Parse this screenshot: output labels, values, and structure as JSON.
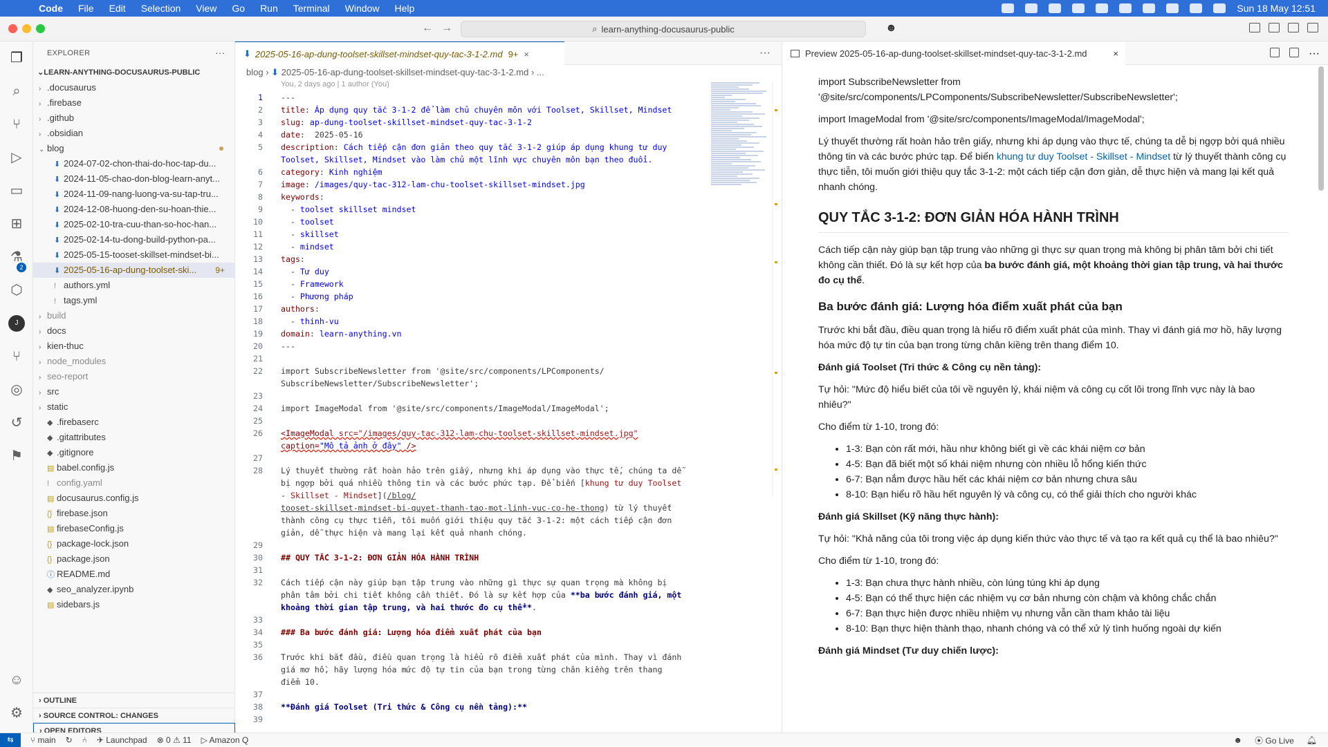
{
  "menubar": {
    "app": "Code",
    "items": [
      "File",
      "Edit",
      "Selection",
      "View",
      "Go",
      "Run",
      "Terminal",
      "Window",
      "Help"
    ],
    "datetime": "Sun 18 May  12:51"
  },
  "titlebar": {
    "search": "learn-anything-docusaurus-public"
  },
  "explorer": {
    "title": "EXPLORER",
    "root": "LEARN-ANYTHING-DOCUSAURUS-PUBLIC",
    "tree": [
      {
        "label": ".docusaurus",
        "depth": 1,
        "kind": "folder"
      },
      {
        "label": ".firebase",
        "depth": 1,
        "kind": "folder"
      },
      {
        "label": ".github",
        "depth": 1,
        "kind": "folder"
      },
      {
        "label": ".obsidian",
        "depth": 1,
        "kind": "folder"
      },
      {
        "label": "blog",
        "depth": 1,
        "kind": "folder-open"
      },
      {
        "label": "2024-07-02-chon-thai-do-hoc-tap-du...",
        "depth": 2,
        "kind": "md"
      },
      {
        "label": "2024-11-05-chao-don-blog-learn-anyt...",
        "depth": 2,
        "kind": "md"
      },
      {
        "label": "2024-11-09-nang-luong-va-su-tap-tru...",
        "depth": 2,
        "kind": "md"
      },
      {
        "label": "2024-12-08-huong-den-su-hoan-thie...",
        "depth": 2,
        "kind": "md"
      },
      {
        "label": "2025-02-10-tra-cuu-than-so-hoc-han...",
        "depth": 2,
        "kind": "md"
      },
      {
        "label": "2025-02-14-tu-dong-build-python-pa...",
        "depth": 2,
        "kind": "md"
      },
      {
        "label": "2025-05-15-tooset-skillset-mindset-bi...",
        "depth": 2,
        "kind": "md"
      },
      {
        "label": "2025-05-16-ap-dung-toolset-ski...",
        "depth": 2,
        "kind": "md",
        "selected": true,
        "badge": "9+"
      },
      {
        "label": "authors.yml",
        "depth": 2,
        "kind": "yml"
      },
      {
        "label": "tags.yml",
        "depth": 2,
        "kind": "yml"
      },
      {
        "label": "build",
        "depth": 1,
        "kind": "folder",
        "dim": true
      },
      {
        "label": "docs",
        "depth": 1,
        "kind": "folder"
      },
      {
        "label": "kien-thuc",
        "depth": 1,
        "kind": "folder"
      },
      {
        "label": "node_modules",
        "depth": 1,
        "kind": "folder",
        "dim": true
      },
      {
        "label": "seo-report",
        "depth": 1,
        "kind": "folder",
        "dim": true
      },
      {
        "label": "src",
        "depth": 1,
        "kind": "folder"
      },
      {
        "label": "static",
        "depth": 1,
        "kind": "folder"
      },
      {
        "label": ".firebaserc",
        "depth": 1,
        "kind": "file"
      },
      {
        "label": ".gitattributes",
        "depth": 1,
        "kind": "file"
      },
      {
        "label": ".gitignore",
        "depth": 1,
        "kind": "file"
      },
      {
        "label": "babel.config.js",
        "depth": 1,
        "kind": "js"
      },
      {
        "label": "config.yaml",
        "depth": 1,
        "kind": "yml",
        "dim": true
      },
      {
        "label": "docusaurus.config.js",
        "depth": 1,
        "kind": "js"
      },
      {
        "label": "firebase.json",
        "depth": 1,
        "kind": "json"
      },
      {
        "label": "firebaseConfig.js",
        "depth": 1,
        "kind": "js"
      },
      {
        "label": "package-lock.json",
        "depth": 1,
        "kind": "json"
      },
      {
        "label": "package.json",
        "depth": 1,
        "kind": "json"
      },
      {
        "label": "README.md",
        "depth": 1,
        "kind": "info"
      },
      {
        "label": "seo_analyzer.ipynb",
        "depth": 1,
        "kind": "file"
      },
      {
        "label": "sidebars.js",
        "depth": 1,
        "kind": "js"
      }
    ],
    "sections": [
      "OUTLINE",
      "SOURCE CONTROL: CHANGES",
      "OPEN EDITORS"
    ]
  },
  "editor": {
    "tab": {
      "name": "2025-05-16-ap-dung-toolset-skillset-mindset-quy-tac-3-1-2.md",
      "badge": "9+"
    },
    "breadcrumb": [
      "blog",
      "2025-05-16-ap-dung-toolset-skillset-mindset-quy-tac-3-1-2.md",
      "..."
    ],
    "blame": "You, 2 days ago | 1 author (You)"
  },
  "preview": {
    "tab": "Preview 2025-05-16-ap-dung-toolset-skillset-mindset-quy-tac-3-1-2.md",
    "import1": "import SubscribeNewsletter from '@site/src/components/LPComponents/SubscribeNewsletter/SubscribeNewsletter';",
    "import2": "import ImageModal from '@site/src/components/ImageModal/ImageModal';",
    "p1a": "Lý thuyết thường rất hoàn hảo trên giấy, nhưng khi áp dụng vào thực tế, chúng ta dễ bị ngợp bởi quá nhiều thông tin và các bước phức tạp. Để biến ",
    "p1link": "khung tư duy Toolset - Skillset - Mindset",
    "p1b": " từ lý thuyết thành công cụ thực tiễn, tôi muốn giới thiệu quy tắc 3-1-2: một cách tiếp cận đơn giản, dễ thực hiện và mang lại kết quả nhanh chóng.",
    "h2": "QUY TẮC 3-1-2: ĐƠN GIẢN HÓA HÀNH TRÌNH",
    "p2a": "Cách tiếp cận này giúp bạn tập trung vào những gì thực sự quan trọng mà không bị phân tâm bởi chi tiết không cần thiết. Đó là sự kết hợp của ",
    "p2b": "ba bước đánh giá, một khoảng thời gian tập trung, và hai thước đo cụ thể",
    "p2c": ".",
    "h3": "Ba bước đánh giá: Lượng hóa điểm xuất phát của bạn",
    "p3": "Trước khi bắt đầu, điều quan trọng là hiểu rõ điểm xuất phát của mình. Thay vì đánh giá mơ hồ, hãy lượng hóa mức độ tự tin của bạn trong từng chân kiềng trên thang điểm 10.",
    "t1": "Đánh giá Toolset (Tri thức & Công cụ nền tảng):",
    "q1": "Tự hỏi: \"Mức độ hiểu biết của tôi về nguyên lý, khái niệm và công cụ cốt lõi trong lĩnh vực này là bao nhiêu?\"",
    "score": "Cho điểm từ 1-10, trong đó:",
    "list1": [
      "1-3: Bạn còn rất mới, hầu như không biết gì về các khái niệm cơ bản",
      "4-5: Bạn đã biết một số khái niệm nhưng còn nhiều lỗ hổng kiến thức",
      "6-7: Bạn nắm được hầu hết các khái niệm cơ bản nhưng chưa sâu",
      "8-10: Bạn hiểu rõ hầu hết nguyên lý và công cụ, có thể giải thích cho người khác"
    ],
    "t2": "Đánh giá Skillset (Kỹ năng thực hành):",
    "q2": "Tự hỏi: \"Khả năng của tôi trong việc áp dụng kiến thức vào thực tế và tạo ra kết quả cụ thể là bao nhiêu?\"",
    "list2": [
      "1-3: Bạn chưa thực hành nhiều, còn lúng túng khi áp dụng",
      "4-5: Bạn có thể thực hiện các nhiệm vụ cơ bản nhưng còn chậm và không chắc chắn",
      "6-7: Bạn thực hiện được nhiều nhiệm vụ nhưng vẫn cần tham khảo tài liệu",
      "8-10: Bạn thực hiện thành thạo, nhanh chóng và có thể xử lý tình huống ngoài dự kiến"
    ],
    "t3": "Đánh giá Mindset (Tư duy chiến lược):"
  },
  "statusbar": {
    "branch": "main",
    "launchpad": "Launchpad",
    "problems": "⊗ 0 ⚠ 11",
    "amazon": "Amazon Q",
    "golive": "Go Live"
  }
}
